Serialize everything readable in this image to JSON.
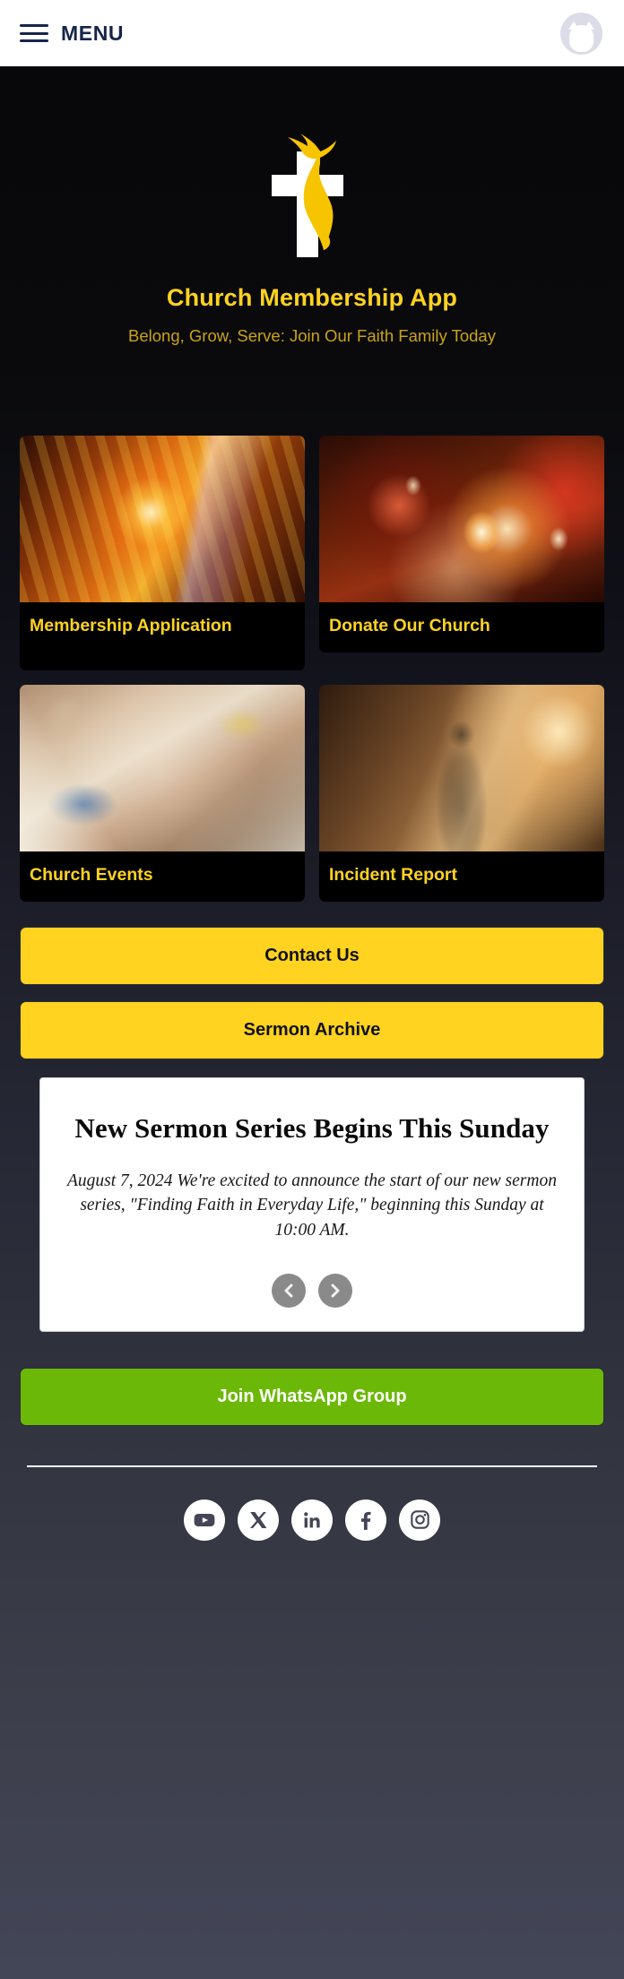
{
  "topbar": {
    "menu_label": "MENU",
    "menu_icon": "hamburger-icon",
    "avatar_icon": "user-avatar-icon"
  },
  "hero": {
    "logo_icon": "cross-dove-flame-logo",
    "title": "Church Membership App",
    "subtitle": "Belong, Grow, Serve: Join Our Faith Family Today",
    "title_color": "#ffd31f",
    "subtitle_color": "#c9a317"
  },
  "cards": [
    {
      "label": "Membership Application",
      "art": "stained-glass-window"
    },
    {
      "label": "Donate Our Church",
      "art": "prayer-candles"
    },
    {
      "label": "Church Events",
      "art": "hands-praying-over-bibles"
    },
    {
      "label": "Incident Report",
      "art": "robed-figure-in-light"
    }
  ],
  "buttons": {
    "contact": "Contact Us",
    "sermon_archive": "Sermon Archive",
    "whatsapp": "Join WhatsApp Group",
    "yellow_color": "#ffd31f",
    "whatsapp_color": "#6cb808"
  },
  "announcement": {
    "title": "New Sermon Series Begins This Sunday",
    "body": "August 7, 2024 We're excited to announce the start of our new sermon series, \"Finding Faith in Everyday Life,\" beginning this Sunday at 10:00 AM.",
    "prev_label": "Previous announcement",
    "next_label": "Next announcement"
  },
  "footer": {
    "socials": [
      {
        "name": "youtube",
        "label": "YouTube"
      },
      {
        "name": "x-twitter",
        "label": "X"
      },
      {
        "name": "linkedin",
        "label": "LinkedIn"
      },
      {
        "name": "facebook",
        "label": "Facebook"
      },
      {
        "name": "instagram",
        "label": "Instagram"
      }
    ]
  }
}
